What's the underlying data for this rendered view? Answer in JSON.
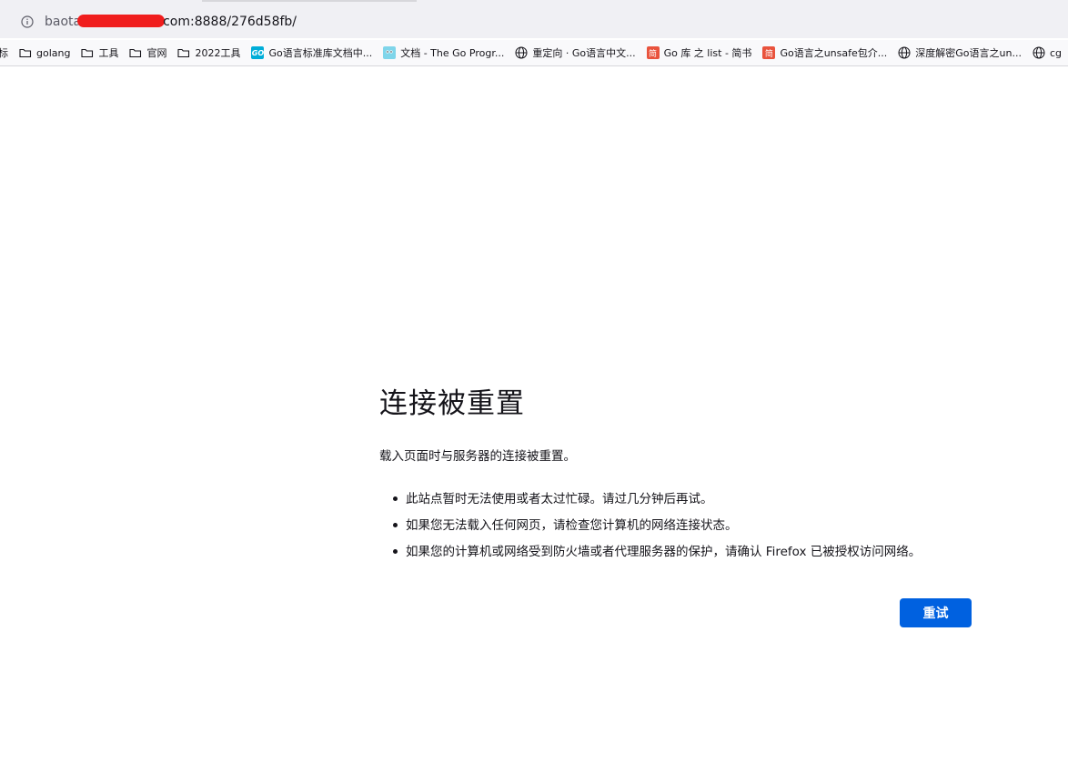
{
  "urlbar": {
    "url_prefix": "baota",
    "url_suffix": "com:8888/276d58fb/"
  },
  "bookmarks": [
    {
      "label": "标",
      "icon": "none"
    },
    {
      "label": "golang",
      "icon": "folder-icon"
    },
    {
      "label": "工具",
      "icon": "folder-icon"
    },
    {
      "label": "官网",
      "icon": "folder-icon"
    },
    {
      "label": "2022工具",
      "icon": "folder-icon"
    },
    {
      "label": "Go语言标准库文档中...",
      "icon": "go-icon"
    },
    {
      "label": "文档 - The Go Progr...",
      "icon": "gopher-icon"
    },
    {
      "label": "重定向 · Go语言中文...",
      "icon": "globe-icon"
    },
    {
      "label": "Go 库 之 list - 简书",
      "icon": "jianshu-icon"
    },
    {
      "label": "Go语言之unsafe包介...",
      "icon": "jianshu-icon"
    },
    {
      "label": "深度解密Go语言之un...",
      "icon": "globe-icon"
    },
    {
      "label": "cg",
      "icon": "globe-icon"
    }
  ],
  "icon_text": {
    "go": "GO",
    "jianshu": "简"
  },
  "error": {
    "title": "连接被重置",
    "lead": "载入页面时与服务器的连接被重置。",
    "reasons": [
      "此站点暂时无法使用或者太过忙碌。请过几分钟后再试。",
      "如果您无法载入任何网页，请检查您计算机的网络连接状态。",
      "如果您的计算机或网络受到防火墙或者代理服务器的保护，请确认 Firefox 已被授权访问网络。"
    ],
    "retry_label": "重试"
  },
  "colors": {
    "accent": "#0061e0",
    "redaction": "#f01d1d"
  }
}
